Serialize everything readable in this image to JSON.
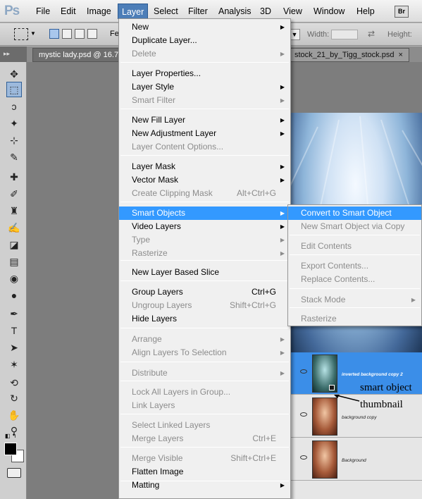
{
  "app": {
    "logo": "Ps",
    "bridge_label": "Br"
  },
  "menubar": [
    "File",
    "Edit",
    "Image",
    "Layer",
    "Select",
    "Filter",
    "Analysis",
    "3D",
    "View",
    "Window",
    "Help"
  ],
  "options_bar": {
    "feather_label": "Fe",
    "width_label": "Width:",
    "height_label": "Height:"
  },
  "tabs": {
    "left": {
      "title": "mystic lady.psd @ 16.7",
      "close": "×"
    },
    "right": {
      "title": "stock_21_by_Tigg_stock.psd",
      "close": "×"
    }
  },
  "layer_menu": [
    {
      "label": "New",
      "submenu": true
    },
    {
      "label": "Duplicate Layer..."
    },
    {
      "label": "Delete",
      "submenu": true,
      "disabled": true
    },
    {
      "separator": true
    },
    {
      "label": "Layer Properties..."
    },
    {
      "label": "Layer Style",
      "submenu": true
    },
    {
      "label": "Smart Filter",
      "submenu": true,
      "disabled": true
    },
    {
      "separator": true
    },
    {
      "label": "New Fill Layer",
      "submenu": true
    },
    {
      "label": "New Adjustment Layer",
      "submenu": true
    },
    {
      "label": "Layer Content Options...",
      "disabled": true
    },
    {
      "separator": true
    },
    {
      "label": "Layer Mask",
      "submenu": true
    },
    {
      "label": "Vector Mask",
      "submenu": true
    },
    {
      "label": "Create Clipping Mask",
      "shortcut": "Alt+Ctrl+G",
      "disabled": true
    },
    {
      "separator": true
    },
    {
      "label": "Smart Objects",
      "submenu": true,
      "highlighted": true
    },
    {
      "label": "Video Layers",
      "submenu": true
    },
    {
      "label": "Type",
      "submenu": true,
      "disabled": true
    },
    {
      "label": "Rasterize",
      "submenu": true,
      "disabled": true
    },
    {
      "separator": true
    },
    {
      "label": "New Layer Based Slice"
    },
    {
      "separator": true
    },
    {
      "label": "Group Layers",
      "shortcut": "Ctrl+G"
    },
    {
      "label": "Ungroup Layers",
      "shortcut": "Shift+Ctrl+G",
      "disabled": true
    },
    {
      "label": "Hide Layers"
    },
    {
      "separator": true
    },
    {
      "label": "Arrange",
      "submenu": true,
      "disabled": true
    },
    {
      "separator": true
    },
    {
      "label": "Align Layers To Selection",
      "submenu": true,
      "disabled": true
    },
    {
      "label": "Distribute",
      "submenu": true,
      "disabled": true
    },
    {
      "separator": true
    },
    {
      "label": "Lock All Layers in Group...",
      "disabled": true
    },
    {
      "separator": true
    },
    {
      "label": "Link Layers",
      "disabled": true
    },
    {
      "label": "Select Linked Layers",
      "disabled": true
    },
    {
      "separator": true
    },
    {
      "label": "Merge Layers",
      "shortcut": "Ctrl+E",
      "disabled": true
    },
    {
      "label": "Merge Visible",
      "shortcut": "Shift+Ctrl+E",
      "disabled": true
    },
    {
      "label": "Flatten Image"
    },
    {
      "separator": true
    },
    {
      "label": "Matting",
      "submenu": true
    }
  ],
  "smart_objects_submenu": [
    {
      "label": "Convert to Smart Object",
      "highlighted": true
    },
    {
      "label": "New Smart Object via Copy",
      "disabled": true
    },
    {
      "separator": true
    },
    {
      "label": "Edit Contents",
      "disabled": true
    },
    {
      "separator": true
    },
    {
      "label": "Export Contents...",
      "disabled": true
    },
    {
      "label": "Replace Contents...",
      "disabled": true
    },
    {
      "separator": true
    },
    {
      "label": "Stack Mode",
      "submenu": true,
      "disabled": true
    },
    {
      "separator": true
    },
    {
      "label": "Rasterize",
      "disabled": true
    }
  ],
  "layers": [
    {
      "name": "inverted background copy 2",
      "active": true,
      "thumb": "inverted",
      "smart": true
    },
    {
      "name": "background copy",
      "active": false,
      "thumb": "girl",
      "smart": false
    },
    {
      "name": "Background",
      "active": false,
      "thumb": "girl",
      "smart": false
    }
  ],
  "annotations": {
    "smart_object": "smart object",
    "thumbnail": "thumbnail"
  },
  "colors": {
    "highlight": "#3399ff",
    "active_layer": "#3b8ee8",
    "menubar_active": "#4d7eb8"
  }
}
